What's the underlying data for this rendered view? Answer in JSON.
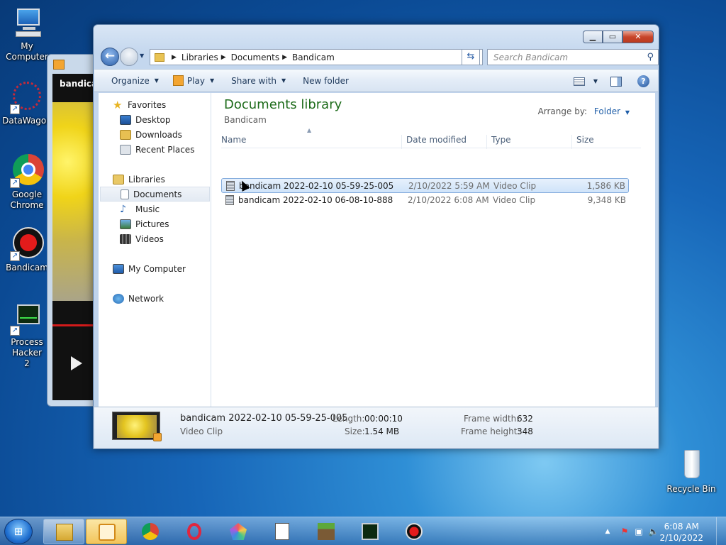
{
  "desktop": {
    "icons": [
      {
        "label": "My Computer"
      },
      {
        "label": "DataWagon"
      },
      {
        "label": "Google Chrome"
      },
      {
        "label": "Bandicam"
      },
      {
        "label": "Process Hacker 2"
      },
      {
        "label": "Recycle Bin"
      }
    ]
  },
  "player": {
    "title": "bandicam"
  },
  "explorer": {
    "breadcrumb": [
      "Libraries",
      "Documents",
      "Bandicam"
    ],
    "search_placeholder": "Search Bandicam",
    "toolbar": {
      "organize": "Organize",
      "play": "Play",
      "share": "Share with",
      "new_folder": "New folder"
    },
    "nav": {
      "favorites": "Favorites",
      "desktop": "Desktop",
      "downloads": "Downloads",
      "recent": "Recent Places",
      "libraries": "Libraries",
      "documents": "Documents",
      "music": "Music",
      "pictures": "Pictures",
      "videos": "Videos",
      "computer": "My Computer",
      "network": "Network"
    },
    "library_title": "Documents library",
    "library_subtitle": "Bandicam",
    "arrange_label": "Arrange by:",
    "arrange_value": "Folder",
    "columns": {
      "name": "Name",
      "date": "Date modified",
      "type": "Type",
      "size": "Size"
    },
    "files": [
      {
        "name": "bandicam 2022-02-10 05-59-25-005",
        "date": "2/10/2022 5:59 AM",
        "type": "Video Clip",
        "size": "1,586 KB"
      },
      {
        "name": "bandicam 2022-02-10 06-08-10-888",
        "date": "2/10/2022 6:08 AM",
        "type": "Video Clip",
        "size": "9,348 KB"
      }
    ],
    "details": {
      "name": "bandicam 2022-02-10 05-59-25-005",
      "kind": "Video Clip",
      "length_label": "Length:",
      "length": "00:00:10",
      "size_label": "Size:",
      "size": "1.54 MB",
      "fw_label": "Frame width:",
      "fw": "632",
      "fh_label": "Frame height:",
      "fh": "348"
    }
  },
  "taskbar": {
    "time": "6:08 AM",
    "date": "2/10/2022"
  },
  "colors": {
    "library_title": "#1d6b1a",
    "accent": "#1f5ea8"
  }
}
